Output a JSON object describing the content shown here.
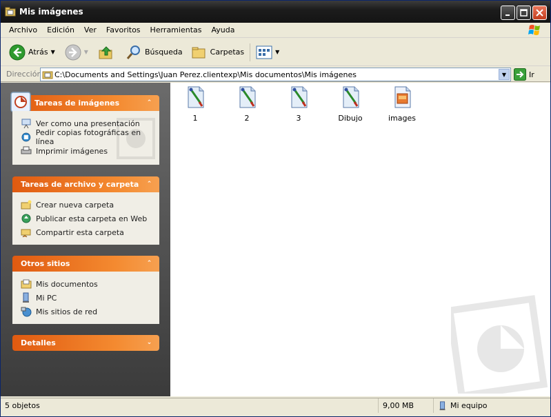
{
  "window": {
    "title": "Mis imágenes",
    "icon": "folder-pictures-icon"
  },
  "menu": [
    "Archivo",
    "Edición",
    "Ver",
    "Favoritos",
    "Herramientas",
    "Ayuda"
  ],
  "toolbar": {
    "back_label": "Atrás",
    "search_label": "Búsqueda",
    "folders_label": "Carpetas"
  },
  "address": {
    "label": "Dirección",
    "path": "C:\\Documents and Settings\\Juan Perez.clientexp\\Mis documentos\\Mis imágenes",
    "go_label": "Ir"
  },
  "panels": {
    "image_tasks": {
      "title": "Tareas de imágenes",
      "items": [
        "Ver como una presentación",
        "Pedir copias fotográficas en línea",
        "Imprimir imágenes"
      ]
    },
    "file_tasks": {
      "title": "Tareas de archivo y carpeta",
      "items": [
        "Crear nueva carpeta",
        "Publicar esta carpeta en Web",
        "Compartir esta carpeta"
      ]
    },
    "other_places": {
      "title": "Otros sitios",
      "items": [
        "Mis documentos",
        "Mi PC",
        "Mis sitios de red"
      ]
    },
    "details": {
      "title": "Detalles"
    }
  },
  "files": [
    {
      "name": "1",
      "type": "paint-image-icon"
    },
    {
      "name": "2",
      "type": "paint-image-icon"
    },
    {
      "name": "3",
      "type": "paint-image-icon"
    },
    {
      "name": "Dibujo",
      "type": "paint-image-icon"
    },
    {
      "name": "images",
      "type": "picture-file-icon"
    }
  ],
  "status": {
    "count": "5 objetos",
    "size": "9,00 MB",
    "location": "Mi equipo"
  },
  "colors": {
    "panel_header": "#e86a1c",
    "pane_background": "#4a4a4a",
    "titlebar": "#1c1c1c"
  }
}
